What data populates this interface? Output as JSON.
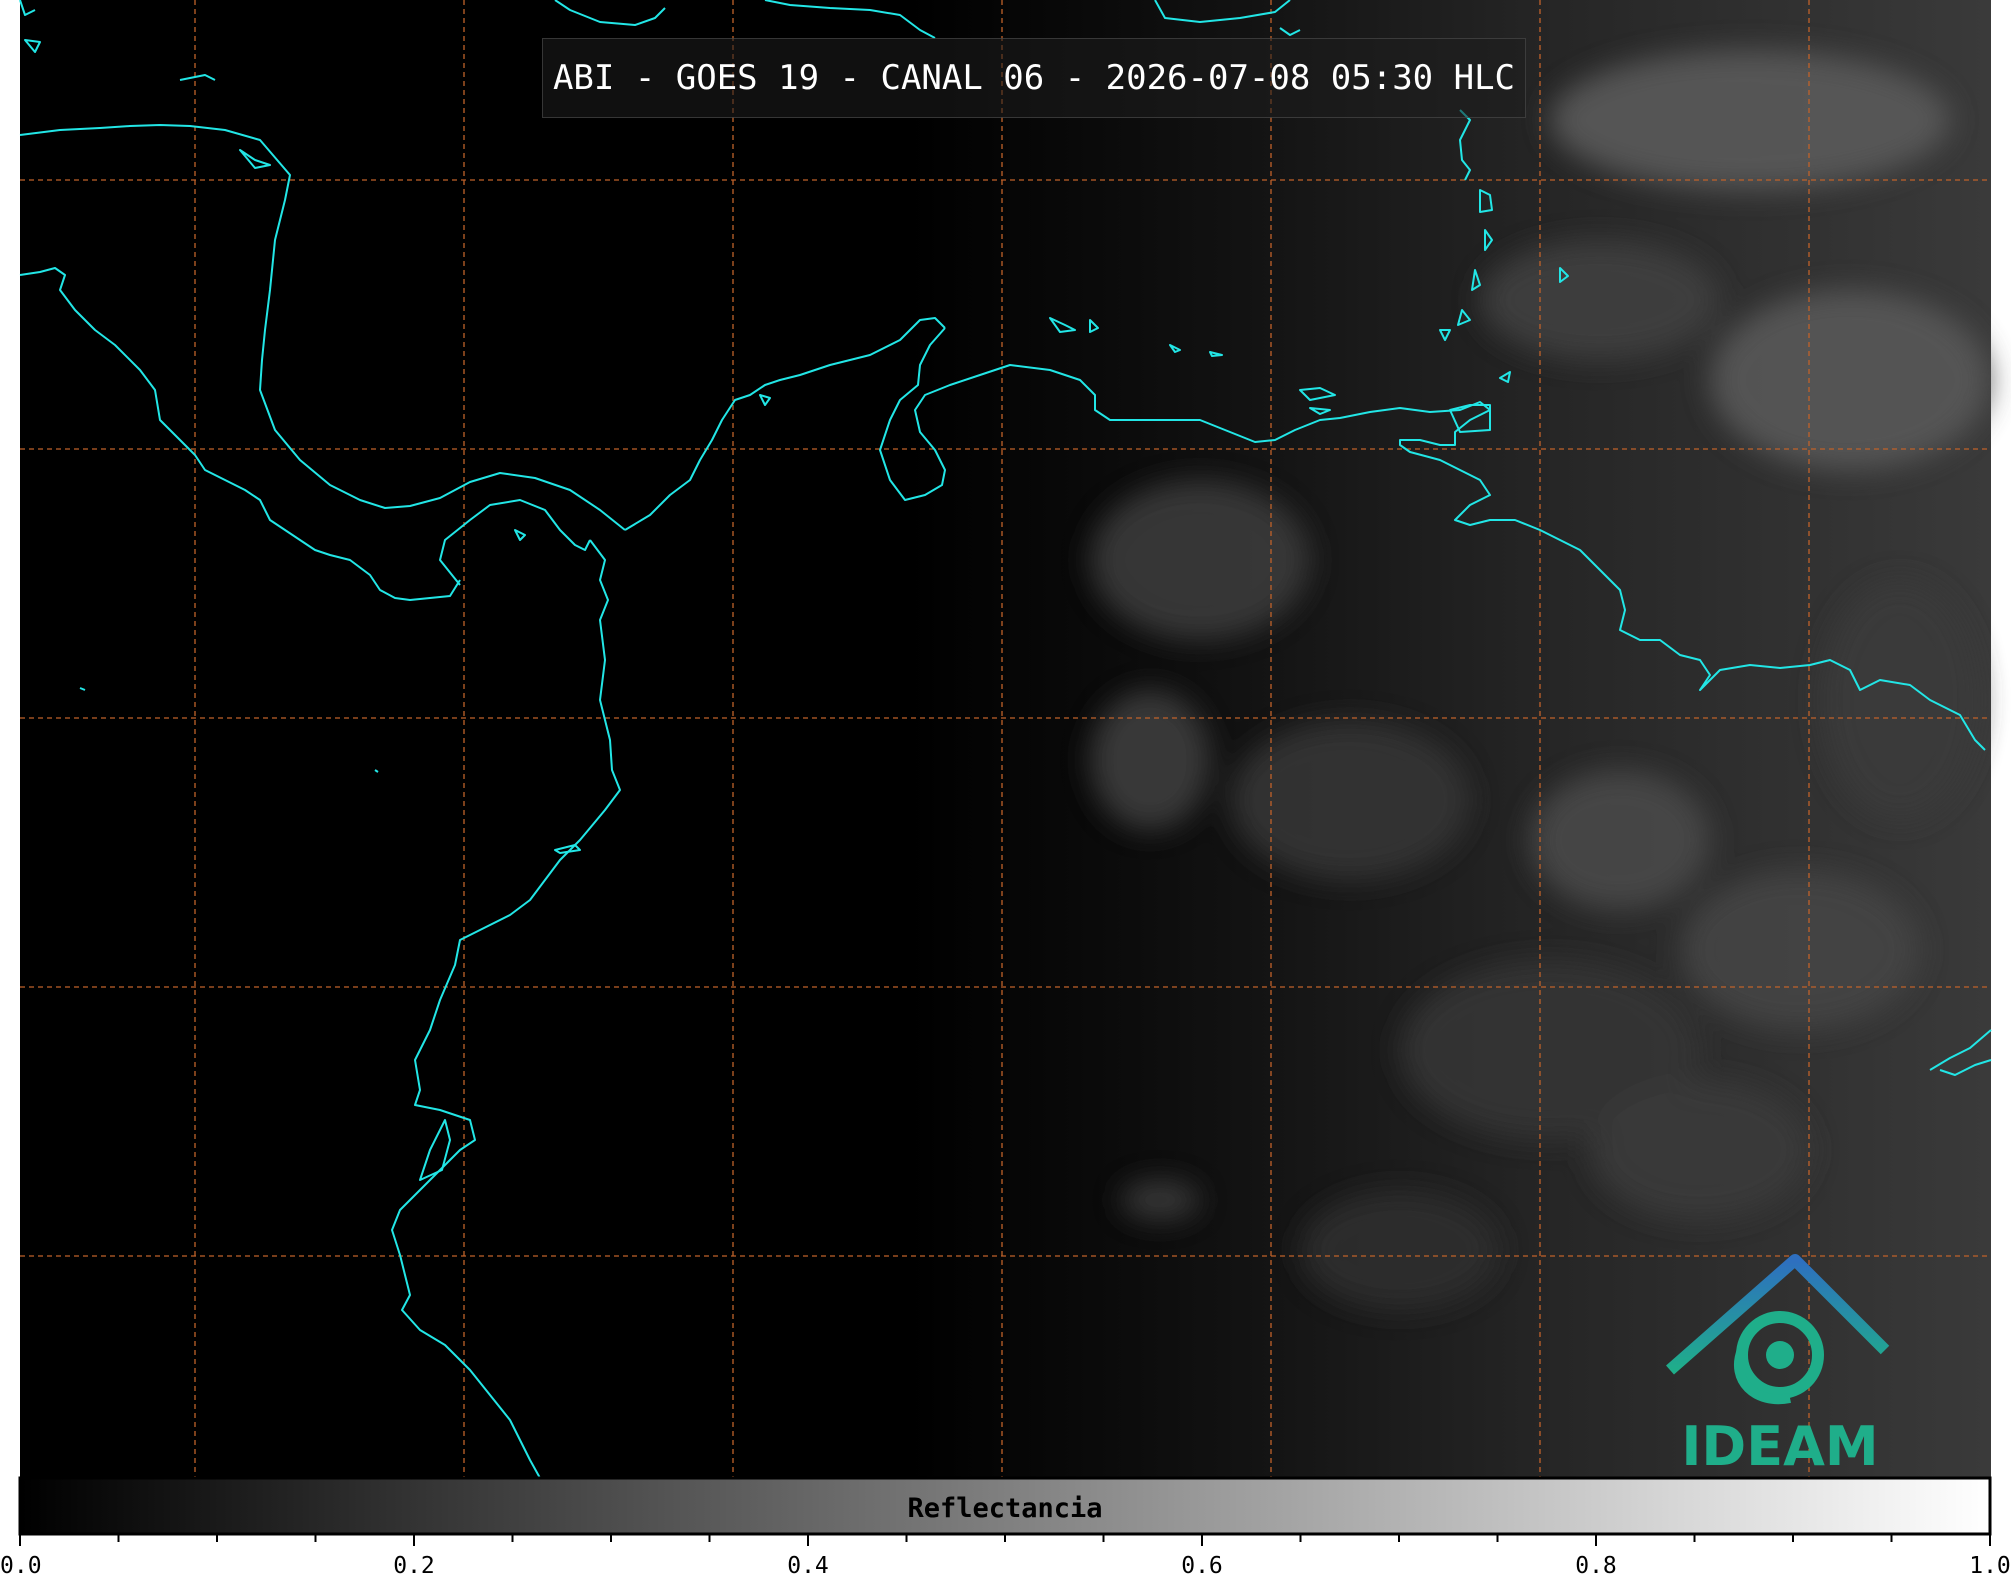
{
  "map": {
    "title": "ABI - GOES 19 - CANAL 06 - 2026-07-08 05:30 HLC",
    "logo_text": "IDEAM",
    "coastline_color": "#22e6e6",
    "grid_color": "#c0622a",
    "colorbar": {
      "label": "Reflectancia",
      "min": 0.0,
      "max": 1.0,
      "ticks": [
        "0.0",
        "0.2",
        "0.4",
        "0.6",
        "0.8",
        "1.0"
      ]
    }
  }
}
